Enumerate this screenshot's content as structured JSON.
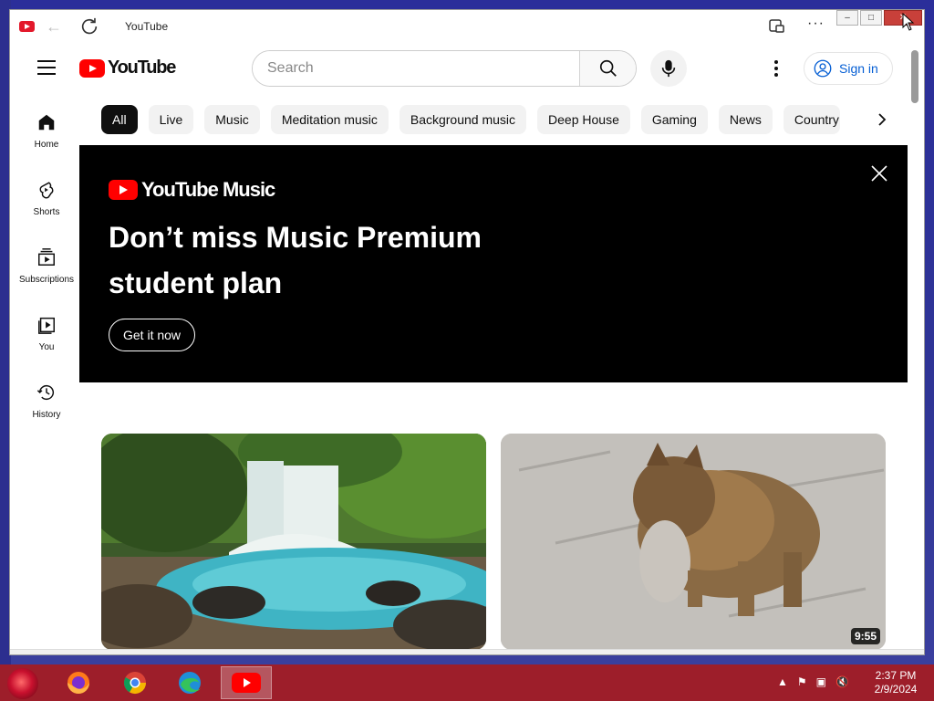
{
  "window": {
    "tab_title": "YouTube"
  },
  "header": {
    "logo_text": "YouTube",
    "search_placeholder": "Search",
    "signin_label": "Sign in"
  },
  "sidebar": {
    "items": [
      {
        "label": "Home",
        "icon": "home-icon"
      },
      {
        "label": "Shorts",
        "icon": "shorts-icon"
      },
      {
        "label": "Subscriptions",
        "icon": "subscriptions-icon"
      },
      {
        "label": "You",
        "icon": "you-icon"
      },
      {
        "label": "History",
        "icon": "history-icon"
      }
    ]
  },
  "chips": [
    "All",
    "Live",
    "Music",
    "Meditation music",
    "Background music",
    "Deep House",
    "Gaming",
    "News",
    "Country"
  ],
  "banner": {
    "logo_text": "YouTube Music",
    "headline": "Don’t miss Music Premium student plan",
    "cta": "Get it now"
  },
  "videos": [
    {
      "thumbnail": "waterfall",
      "duration": ""
    },
    {
      "thumbnail": "cat-carrying-kitten",
      "duration": "9:55"
    }
  ],
  "taskbar": {
    "time": "2:37 PM",
    "date": "2/9/2024"
  },
  "colors": {
    "brand_red": "#ff0000",
    "link_blue": "#065fd4",
    "taskbar": "#9d1e2a"
  }
}
